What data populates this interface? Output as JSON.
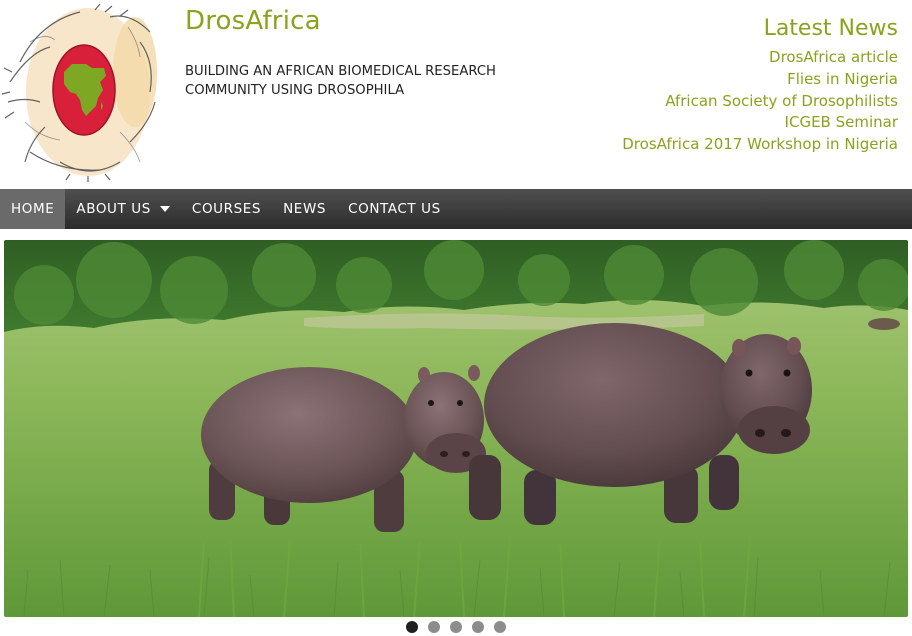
{
  "site": {
    "title": "DrosAfrica",
    "tagline": "BUILDING AN AFRICAN BIOMEDICAL RESEARCH COMMUNITY USING DROSOPHILA"
  },
  "news": {
    "heading": "Latest News",
    "items": [
      "DrosAfrica article",
      "Flies in Nigeria",
      "African Society of Drosophilists",
      "ICGEB Seminar",
      "DrosAfrica 2017 Workshop in Nigeria"
    ]
  },
  "nav": {
    "items": [
      {
        "label": "HOME",
        "active": true
      },
      {
        "label": "ABOUT US",
        "dropdown": true
      },
      {
        "label": "COURSES"
      },
      {
        "label": "NEWS"
      },
      {
        "label": "CONTACT US"
      }
    ]
  },
  "slider": {
    "slide_count": 5,
    "active_index": 0
  },
  "colors": {
    "accent": "#8aa31f",
    "nav_bg": "#3a3a3a",
    "nav_active": "#6a6a6a",
    "logo_red": "#d8203a",
    "logo_africa": "#7ea824"
  }
}
